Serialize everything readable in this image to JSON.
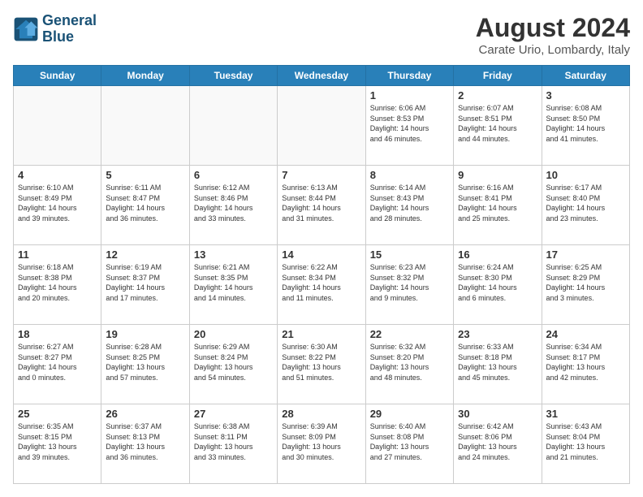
{
  "header": {
    "logo_line1": "General",
    "logo_line2": "Blue",
    "title": "August 2024",
    "subtitle": "Carate Urio, Lombardy, Italy"
  },
  "days_of_week": [
    "Sunday",
    "Monday",
    "Tuesday",
    "Wednesday",
    "Thursday",
    "Friday",
    "Saturday"
  ],
  "weeks": [
    [
      {
        "day": "",
        "info": ""
      },
      {
        "day": "",
        "info": ""
      },
      {
        "day": "",
        "info": ""
      },
      {
        "day": "",
        "info": ""
      },
      {
        "day": "1",
        "info": "Sunrise: 6:06 AM\nSunset: 8:53 PM\nDaylight: 14 hours\nand 46 minutes."
      },
      {
        "day": "2",
        "info": "Sunrise: 6:07 AM\nSunset: 8:51 PM\nDaylight: 14 hours\nand 44 minutes."
      },
      {
        "day": "3",
        "info": "Sunrise: 6:08 AM\nSunset: 8:50 PM\nDaylight: 14 hours\nand 41 minutes."
      }
    ],
    [
      {
        "day": "4",
        "info": "Sunrise: 6:10 AM\nSunset: 8:49 PM\nDaylight: 14 hours\nand 39 minutes."
      },
      {
        "day": "5",
        "info": "Sunrise: 6:11 AM\nSunset: 8:47 PM\nDaylight: 14 hours\nand 36 minutes."
      },
      {
        "day": "6",
        "info": "Sunrise: 6:12 AM\nSunset: 8:46 PM\nDaylight: 14 hours\nand 33 minutes."
      },
      {
        "day": "7",
        "info": "Sunrise: 6:13 AM\nSunset: 8:44 PM\nDaylight: 14 hours\nand 31 minutes."
      },
      {
        "day": "8",
        "info": "Sunrise: 6:14 AM\nSunset: 8:43 PM\nDaylight: 14 hours\nand 28 minutes."
      },
      {
        "day": "9",
        "info": "Sunrise: 6:16 AM\nSunset: 8:41 PM\nDaylight: 14 hours\nand 25 minutes."
      },
      {
        "day": "10",
        "info": "Sunrise: 6:17 AM\nSunset: 8:40 PM\nDaylight: 14 hours\nand 23 minutes."
      }
    ],
    [
      {
        "day": "11",
        "info": "Sunrise: 6:18 AM\nSunset: 8:38 PM\nDaylight: 14 hours\nand 20 minutes."
      },
      {
        "day": "12",
        "info": "Sunrise: 6:19 AM\nSunset: 8:37 PM\nDaylight: 14 hours\nand 17 minutes."
      },
      {
        "day": "13",
        "info": "Sunrise: 6:21 AM\nSunset: 8:35 PM\nDaylight: 14 hours\nand 14 minutes."
      },
      {
        "day": "14",
        "info": "Sunrise: 6:22 AM\nSunset: 8:34 PM\nDaylight: 14 hours\nand 11 minutes."
      },
      {
        "day": "15",
        "info": "Sunrise: 6:23 AM\nSunset: 8:32 PM\nDaylight: 14 hours\nand 9 minutes."
      },
      {
        "day": "16",
        "info": "Sunrise: 6:24 AM\nSunset: 8:30 PM\nDaylight: 14 hours\nand 6 minutes."
      },
      {
        "day": "17",
        "info": "Sunrise: 6:25 AM\nSunset: 8:29 PM\nDaylight: 14 hours\nand 3 minutes."
      }
    ],
    [
      {
        "day": "18",
        "info": "Sunrise: 6:27 AM\nSunset: 8:27 PM\nDaylight: 14 hours\nand 0 minutes."
      },
      {
        "day": "19",
        "info": "Sunrise: 6:28 AM\nSunset: 8:25 PM\nDaylight: 13 hours\nand 57 minutes."
      },
      {
        "day": "20",
        "info": "Sunrise: 6:29 AM\nSunset: 8:24 PM\nDaylight: 13 hours\nand 54 minutes."
      },
      {
        "day": "21",
        "info": "Sunrise: 6:30 AM\nSunset: 8:22 PM\nDaylight: 13 hours\nand 51 minutes."
      },
      {
        "day": "22",
        "info": "Sunrise: 6:32 AM\nSunset: 8:20 PM\nDaylight: 13 hours\nand 48 minutes."
      },
      {
        "day": "23",
        "info": "Sunrise: 6:33 AM\nSunset: 8:18 PM\nDaylight: 13 hours\nand 45 minutes."
      },
      {
        "day": "24",
        "info": "Sunrise: 6:34 AM\nSunset: 8:17 PM\nDaylight: 13 hours\nand 42 minutes."
      }
    ],
    [
      {
        "day": "25",
        "info": "Sunrise: 6:35 AM\nSunset: 8:15 PM\nDaylight: 13 hours\nand 39 minutes."
      },
      {
        "day": "26",
        "info": "Sunrise: 6:37 AM\nSunset: 8:13 PM\nDaylight: 13 hours\nand 36 minutes."
      },
      {
        "day": "27",
        "info": "Sunrise: 6:38 AM\nSunset: 8:11 PM\nDaylight: 13 hours\nand 33 minutes."
      },
      {
        "day": "28",
        "info": "Sunrise: 6:39 AM\nSunset: 8:09 PM\nDaylight: 13 hours\nand 30 minutes."
      },
      {
        "day": "29",
        "info": "Sunrise: 6:40 AM\nSunset: 8:08 PM\nDaylight: 13 hours\nand 27 minutes."
      },
      {
        "day": "30",
        "info": "Sunrise: 6:42 AM\nSunset: 8:06 PM\nDaylight: 13 hours\nand 24 minutes."
      },
      {
        "day": "31",
        "info": "Sunrise: 6:43 AM\nSunset: 8:04 PM\nDaylight: 13 hours\nand 21 minutes."
      }
    ]
  ]
}
